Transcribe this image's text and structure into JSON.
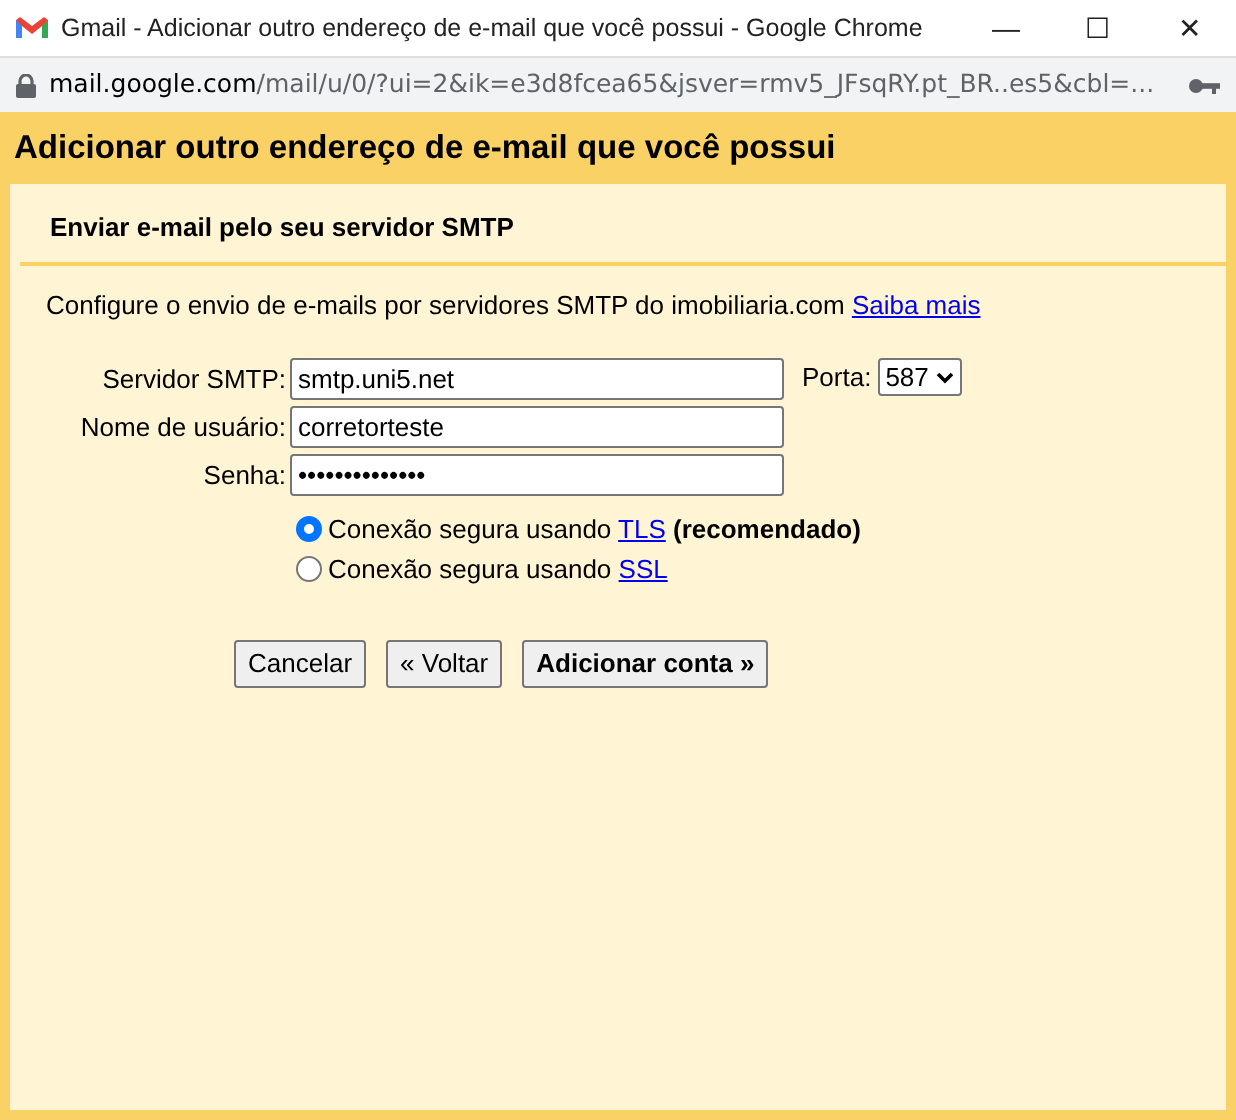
{
  "window": {
    "title": "Gmail - Adicionar outro endereço de e-mail que você possui - Google Chrome",
    "controls": [
      "—",
      "☐",
      "✕"
    ]
  },
  "address_bar": {
    "host": "mail.google.com",
    "path": "/mail/u/0/?ui=2&ik=e3d8fcea65&jsver=rmv5_JFsqRY.pt_BR..es5&cbl=..."
  },
  "heading": "Adicionar outro endereço de e-mail que você possui",
  "section_title": "Enviar e-mail pelo seu servidor SMTP",
  "intro": {
    "text": "Configure o envio de e-mails por servidores SMTP do imobiliaria.com",
    "link": "Saiba mais"
  },
  "fields": [
    {
      "label": "Servidor SMTP:",
      "value": "smtp.uni5.net"
    },
    {
      "label": "Nome de usuário:",
      "value": "corretorteste"
    },
    {
      "label": "Senha:",
      "value": "••••••••••••••"
    }
  ],
  "port": {
    "label": "Porta:",
    "value": "587"
  },
  "security_options": [
    {
      "text": "Conexão segura usando",
      "link": "TLS",
      "note": "(recomendado)",
      "selected": true
    },
    {
      "text": "Conexão segura usando",
      "link": "SSL",
      "selected": false
    }
  ],
  "buttons": [
    {
      "label": "Cancelar",
      "primary": false
    },
    {
      "label": "« Voltar",
      "primary": false
    },
    {
      "label": "Adicionar conta »",
      "primary": true
    }
  ]
}
